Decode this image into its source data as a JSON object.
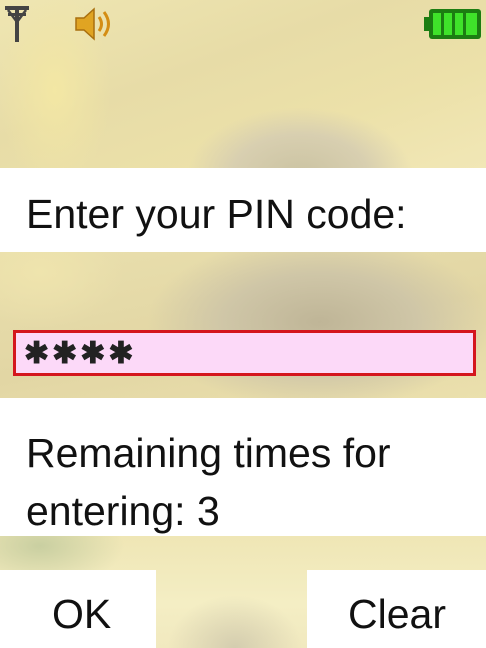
{
  "status_bar": {
    "signal_icon": "signal-antenna-icon",
    "sound_icon": "speaker-volume-icon",
    "battery_icon": "battery-full-icon",
    "battery_level": 1.0
  },
  "prompt": {
    "text": "Enter your PIN code:"
  },
  "pin_input": {
    "value": "✱✱✱✱"
  },
  "remaining": {
    "text": "Remaining times for entering: 3"
  },
  "softkeys": {
    "left_label": "OK",
    "right_label": "Clear"
  },
  "colors": {
    "input_border": "#d4161d",
    "input_background": "#fcd9f8",
    "battery": "#2fc21a"
  }
}
